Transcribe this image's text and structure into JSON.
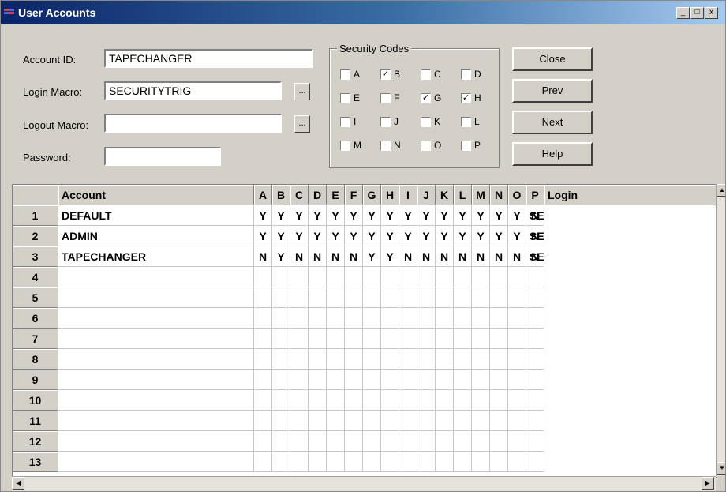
{
  "window": {
    "title": "User Accounts",
    "controls": {
      "minimize": "_",
      "maximize": "□",
      "close": "x"
    }
  },
  "form": {
    "account_id": {
      "label": "Account ID:",
      "value": "TAPECHANGER"
    },
    "login_macro": {
      "label": "Login Macro:",
      "value": "SECURITYTRIG",
      "browse": "..."
    },
    "logout_macro": {
      "label": "Logout Macro:",
      "value": "",
      "browse": "..."
    },
    "password": {
      "label": "Password:",
      "value": ""
    }
  },
  "security_codes": {
    "title": "Security Codes",
    "codes": [
      {
        "letter": "A",
        "checked": false
      },
      {
        "letter": "B",
        "checked": true
      },
      {
        "letter": "C",
        "checked": false
      },
      {
        "letter": "D",
        "checked": false
      },
      {
        "letter": "E",
        "checked": false
      },
      {
        "letter": "F",
        "checked": false
      },
      {
        "letter": "G",
        "checked": true
      },
      {
        "letter": "H",
        "checked": true
      },
      {
        "letter": "I",
        "checked": false
      },
      {
        "letter": "J",
        "checked": false
      },
      {
        "letter": "K",
        "checked": false
      },
      {
        "letter": "L",
        "checked": false
      },
      {
        "letter": "M",
        "checked": false
      },
      {
        "letter": "N",
        "checked": false
      },
      {
        "letter": "O",
        "checked": false
      },
      {
        "letter": "P",
        "checked": false
      }
    ]
  },
  "buttons": {
    "close": "Close",
    "prev": "Prev",
    "next": "Next",
    "help": "Help"
  },
  "grid": {
    "headers": [
      "Account",
      "A",
      "B",
      "C",
      "D",
      "E",
      "F",
      "G",
      "H",
      "I",
      "J",
      "K",
      "L",
      "M",
      "N",
      "O",
      "P",
      "Login"
    ],
    "rows": [
      {
        "num": "1",
        "account": "DEFAULT",
        "codes": [
          "Y",
          "Y",
          "Y",
          "Y",
          "Y",
          "Y",
          "Y",
          "Y",
          "Y",
          "Y",
          "Y",
          "Y",
          "Y",
          "Y",
          "Y",
          "N"
        ],
        "login": "SECURITYTRIG"
      },
      {
        "num": "2",
        "account": "ADMIN",
        "codes": [
          "Y",
          "Y",
          "Y",
          "Y",
          "Y",
          "Y",
          "Y",
          "Y",
          "Y",
          "Y",
          "Y",
          "Y",
          "Y",
          "Y",
          "Y",
          "N"
        ],
        "login": "SECURITYTRIG"
      },
      {
        "num": "3",
        "account": "TAPECHANGER",
        "codes": [
          "N",
          "Y",
          "N",
          "N",
          "N",
          "N",
          "Y",
          "Y",
          "N",
          "N",
          "N",
          "N",
          "N",
          "N",
          "N",
          "N"
        ],
        "login": "SECURITYTRIG"
      },
      {
        "num": "4",
        "account": "",
        "codes": [],
        "login": ""
      },
      {
        "num": "5",
        "account": "",
        "codes": [],
        "login": ""
      },
      {
        "num": "6",
        "account": "",
        "codes": [],
        "login": ""
      },
      {
        "num": "7",
        "account": "",
        "codes": [],
        "login": ""
      },
      {
        "num": "8",
        "account": "",
        "codes": [],
        "login": ""
      },
      {
        "num": "9",
        "account": "",
        "codes": [],
        "login": ""
      },
      {
        "num": "10",
        "account": "",
        "codes": [],
        "login": ""
      },
      {
        "num": "11",
        "account": "",
        "codes": [],
        "login": ""
      },
      {
        "num": "12",
        "account": "",
        "codes": [],
        "login": ""
      },
      {
        "num": "13",
        "account": "",
        "codes": [],
        "login": ""
      }
    ],
    "scroll_icons": {
      "up": "▲",
      "down": "▼",
      "left": "◀",
      "right": "▶"
    }
  }
}
